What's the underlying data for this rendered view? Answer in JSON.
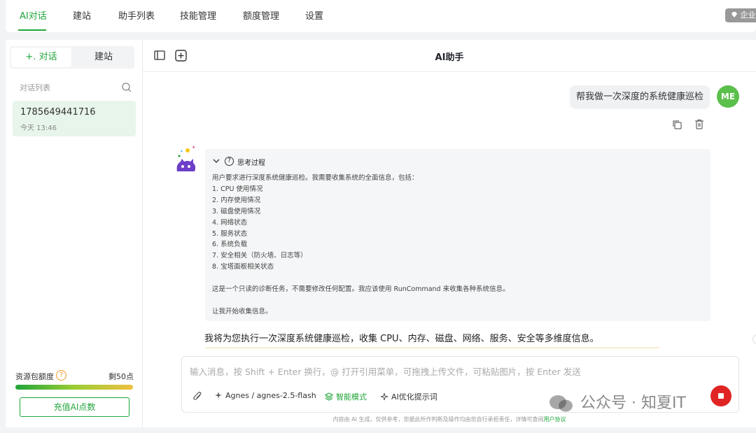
{
  "topnav": {
    "tabs": [
      "AI对话",
      "建站",
      "助手列表",
      "技能管理",
      "额度管理",
      "设置"
    ],
    "active_tab": "AI对话",
    "enterprise_badge": "企业版"
  },
  "sidebar": {
    "segments": [
      "对话",
      "建站"
    ],
    "segment_prefix": "+.",
    "list_title": "对话列表",
    "conversations": [
      {
        "title": "1785649441716",
        "time": "今天 13:46"
      }
    ],
    "quota": {
      "label": "资源包额度",
      "help_icon": "?",
      "value": "剩50点",
      "fill_percent": 100
    },
    "recharge_label": "充值AI点数"
  },
  "main": {
    "title": "AI助手",
    "user_avatar": "ME",
    "user_message": "帮我做一次深度的系统健康巡检",
    "thinking": {
      "label": "思考过程",
      "lines": [
        "用户要求进行深度系统健康巡检。我需要收集系统的全面信息，包括：",
        "1. CPU 使用情况",
        "2. 内存使用情况",
        "3. 磁盘使用情况",
        "4. 网络状态",
        "5. 服务状态",
        "6. 系统负载",
        "7. 安全相关（防火墙、日志等）",
        "8. 宝塔面板相关状态",
        "",
        "这是一个只读的诊断任务，不需要修改任何配置。我应该使用 RunCommand 来收集各种系统信息。",
        "",
        "让我开始收集信息。"
      ]
    },
    "answer": "我将为您执行一次深度系统健康巡检，收集 CPU、内存、磁盘、网络、服务、安全等多维度信息。",
    "input": {
      "placeholder": "输入消息，按 Shift + Enter 换行，@ 打开引用菜单，可拖拽上传文件，可粘贴图片，按 Enter 发送",
      "model": "Agnes / agnes-2.5-flash",
      "smart_mode": "智能模式",
      "optimize": "AI优化提示词"
    },
    "disclaimer": "内容由 AI 生成，仅供参考，您据此所作判断及操作均由您自行承担责任，详情可查阅",
    "disclaimer_link": "用户协议"
  },
  "watermark": "公众号 · 知夏IT",
  "colors": {
    "accent": "#20a53a",
    "stop": "#e02424",
    "avatar": "#5bbf4b"
  }
}
